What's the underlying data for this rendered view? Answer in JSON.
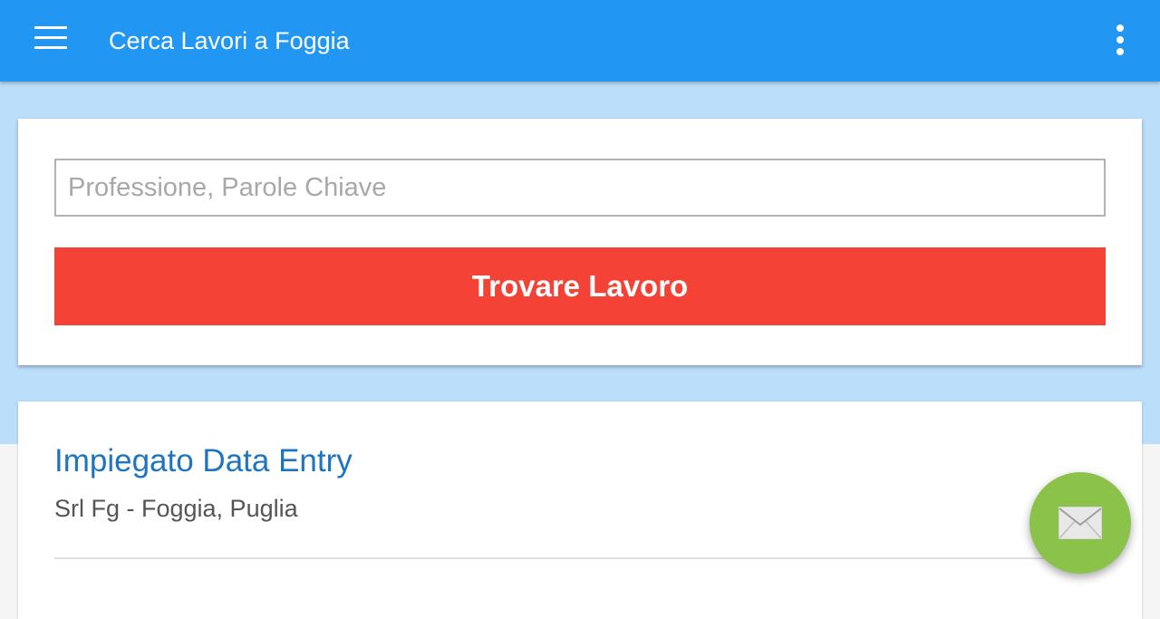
{
  "app_bar": {
    "title": "Cerca Lavori a Foggia",
    "menu_icon": "hamburger-menu-icon",
    "overflow_icon": "more-vert-icon",
    "color": "#2196f3"
  },
  "search": {
    "placeholder": "Professione, Parole Chiave",
    "value": "",
    "button_label": "Trovare Lavoro",
    "button_color": "#f44336"
  },
  "jobs": [
    {
      "title": "Impiegato Data Entry",
      "location": "Srl Fg - Foggia, Puglia"
    }
  ],
  "fab": {
    "icon": "mail-icon",
    "color": "#8bc34a"
  }
}
